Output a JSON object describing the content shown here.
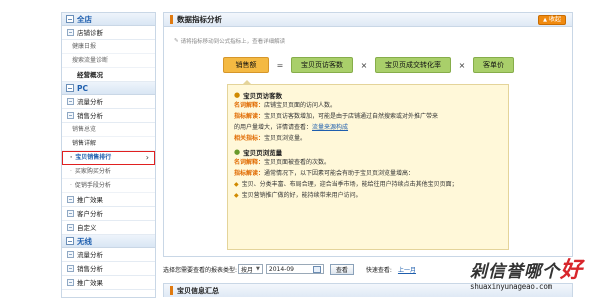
{
  "sidebar": {
    "group_all": "全店",
    "all_items": [
      "店铺诊断",
      "健康日报",
      "搜索流量诊断",
      "经营概况"
    ],
    "group_pc": "PC",
    "pc_traffic": "流量分析",
    "pc_sales": "销售分析",
    "sales_subs": [
      "销售总览",
      "销售详解"
    ],
    "active_item": "宝贝销售排行",
    "active_arrow": "›",
    "after_active": [
      "买家购买分析",
      "促销手段分析"
    ],
    "pc_more": [
      "推广效果",
      "客户分析",
      "自定义"
    ],
    "group_wireless": "无线",
    "wireless_items": [
      "流量分析",
      "销售分析",
      "推广效果"
    ]
  },
  "main": {
    "title": "数据指标分析",
    "collapse_label": "收起",
    "hint": "请将指标移动到公式指标上，查看详细解读",
    "formula": {
      "sales": "销售额",
      "visitors": "宝贝页访客数",
      "conversion": "宝贝页成交转化率",
      "price": "客单价",
      "eq": "=",
      "times": "×"
    },
    "info": {
      "sec1_title": "宝贝页访客数",
      "sec1_name_key": "名词解释：",
      "sec1_name_val": "店铺宝贝页面的访问人数。",
      "sec1_idx_key": "指标解读：",
      "sec1_idx_val": "宝贝页访客数增加，可能是由于店铺通过自然搜索或对外推广带来",
      "sec1_idx_val2": "的用户量增大，详情请查看：",
      "sec1_link": "流量来源构成",
      "sec1_rel_key": "相关指标：",
      "sec1_rel_val": "宝贝页浏览量。",
      "sec2_title": "宝贝页浏览量",
      "sec2_name_key": "名词解释：",
      "sec2_name_val": "宝贝页面被查看的次数。",
      "sec2_idx_key": "指标解读：",
      "sec2_idx_val": "通常情况下，以下因素可能会有助于宝贝页浏览量增高：",
      "bullet1": "宝贝、分类丰富、布局合理，迎合当季市场，能给往用户持续点击其他宝贝页面；",
      "bullet2": "宝贝营销推广做的好，能持续带来用户访问。"
    }
  },
  "controls": {
    "label": "选择您需要查看的报表类型:",
    "period": "按月",
    "date": "2014-09",
    "query": "查看",
    "quick": "快速查看:",
    "prev": "上一月"
  },
  "sub_section": {
    "title": "宝贝信息汇总"
  },
  "watermark": {
    "text": "剁信誉哪个",
    "highlight": "好",
    "url": "shuaxinyunageao.com"
  },
  "colors": {
    "accent_orange": "#f4b942",
    "accent_green": "#a9cf6a",
    "active_border": "#e02020",
    "link_blue": "#1f5fae"
  }
}
